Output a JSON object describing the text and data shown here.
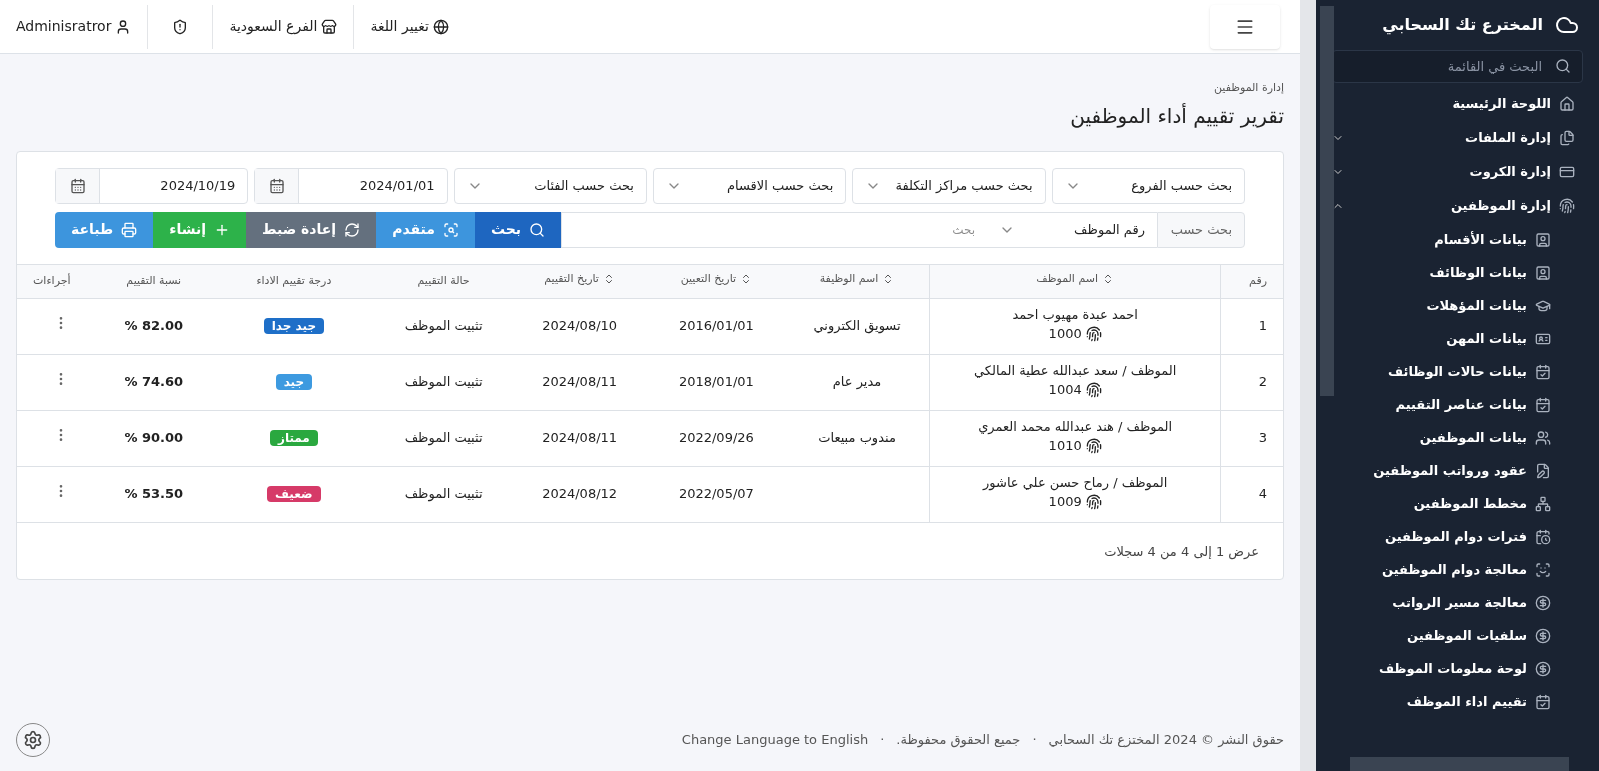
{
  "topbar": {
    "language": "تغيير اللغة",
    "branch": "الفرع السعودية",
    "user": "Adminisratror"
  },
  "page": {
    "breadcrumb": "إدارة الموظفين",
    "title": "تقرير تقييم أداء الموظفين"
  },
  "filters": {
    "selects": [
      {
        "placeholder": "بحث حسب الفروع"
      },
      {
        "placeholder": "بحث حسب مراكز التكلفة"
      },
      {
        "placeholder": "بحث حسب الاقسام"
      },
      {
        "placeholder": "بحث حسب الفئات"
      }
    ],
    "dates": [
      {
        "value": "2024/01/01"
      },
      {
        "value": "2024/10/19"
      }
    ],
    "search": {
      "label": "بحث حسب",
      "field": "رقم الموظف",
      "placeholder": "بحث"
    },
    "buttons": [
      {
        "kind": "search",
        "label": "بحث"
      },
      {
        "kind": "advanced",
        "label": "متقدم"
      },
      {
        "kind": "reset",
        "label": "إعادة ضبط"
      },
      {
        "kind": "create",
        "label": "إنشاء"
      },
      {
        "kind": "print",
        "label": "طباعة"
      }
    ]
  },
  "table": {
    "columns": [
      {
        "label": "رقم",
        "sortable": false
      },
      {
        "label": "اسم الموظف",
        "sortable": true
      },
      {
        "label": "اسم الوظيفة",
        "sortable": true
      },
      {
        "label": "تاريخ التعيين",
        "sortable": true
      },
      {
        "label": "تاريخ التقييم",
        "sortable": true
      },
      {
        "label": "حالة التقييم",
        "sortable": false
      },
      {
        "label": "درجة تقييم الاداء",
        "sortable": false
      },
      {
        "label": "نسبة التقييم",
        "sortable": false
      },
      {
        "label": "أجراءات",
        "sortable": false
      }
    ],
    "rows": [
      {
        "no": "1",
        "name": "احمد عبدة مهيوب احمد",
        "code": "1000",
        "job": "تسويق الكتروني",
        "hired": "2016/01/01",
        "evaluated": "2024/08/10",
        "status": "تثبيت الموظف",
        "grade": "جيد جدا",
        "color": "#1e6fc8",
        "percent": "82.00 %"
      },
      {
        "no": "2",
        "name": "الموظف / سعد عبدالله عطية المالكي",
        "code": "1004",
        "job": "مدير عام",
        "hired": "2018/01/01",
        "evaluated": "2024/08/11",
        "status": "تثبيت الموظف",
        "grade": "جيد",
        "color": "#3d9ae0",
        "percent": "74.60 %"
      },
      {
        "no": "3",
        "name": "الموظف / هند عبدالله محمد العمري",
        "code": "1010",
        "job": "مندوب مبيعات",
        "hired": "2022/09/26",
        "evaluated": "2024/08/11",
        "status": "تثبيت الموظف",
        "grade": "ممتاز",
        "color": "#2aa83f",
        "percent": "90.00 %"
      },
      {
        "no": "4",
        "name": "الموظف / رماح حسن علي عاشور",
        "code": "1009",
        "job": "",
        "hired": "2022/05/07",
        "evaluated": "2024/08/12",
        "status": "تثبيت الموظف",
        "grade": "ضعيف",
        "color": "#d63a68",
        "percent": "53.50 %"
      }
    ],
    "summary": "عرض 1 إلى 4 من 4 سجلات"
  },
  "footer": {
    "separator": "·",
    "copyright": "حقوق النشر © 2024 المختزع تك السحابي",
    "rights": "جميع الحقوق محفوظة.",
    "language_link": "Change Language to English"
  },
  "sidebar": {
    "brand": "المخترع تك السحابي",
    "search_placeholder": "البحث في القائمة",
    "items": [
      {
        "kind": "link",
        "label": "اللوحة الرئيسية"
      },
      {
        "kind": "group",
        "label": "إدارة الملفات",
        "expanded": false
      },
      {
        "kind": "group",
        "label": "إدارة الكروت",
        "expanded": false
      },
      {
        "kind": "group",
        "label": "إدارة الموظفين",
        "expanded": true,
        "children": [
          {
            "label": "بيانات الأقسام"
          },
          {
            "label": "بيانات الوظائف"
          },
          {
            "label": "بيانات المؤهلات"
          },
          {
            "label": "بيانات المهن"
          },
          {
            "label": "بيانات حالات الوظائف"
          },
          {
            "label": "بيانات عناصر التقييم"
          },
          {
            "label": "بيانات الموظفين"
          },
          {
            "label": "عقود ورواتب الموظفين"
          },
          {
            "label": "مخطط الموظفين"
          },
          {
            "label": "فترات دوام الموظفين"
          },
          {
            "label": "معالجة دوام الموظفين"
          },
          {
            "label": "معالجة مسير الرواتب"
          },
          {
            "label": "سلفيات الموظفين"
          },
          {
            "label": "لوحة معلومات الموظف"
          },
          {
            "label": "تقييم اداء الموظف"
          }
        ]
      }
    ]
  }
}
